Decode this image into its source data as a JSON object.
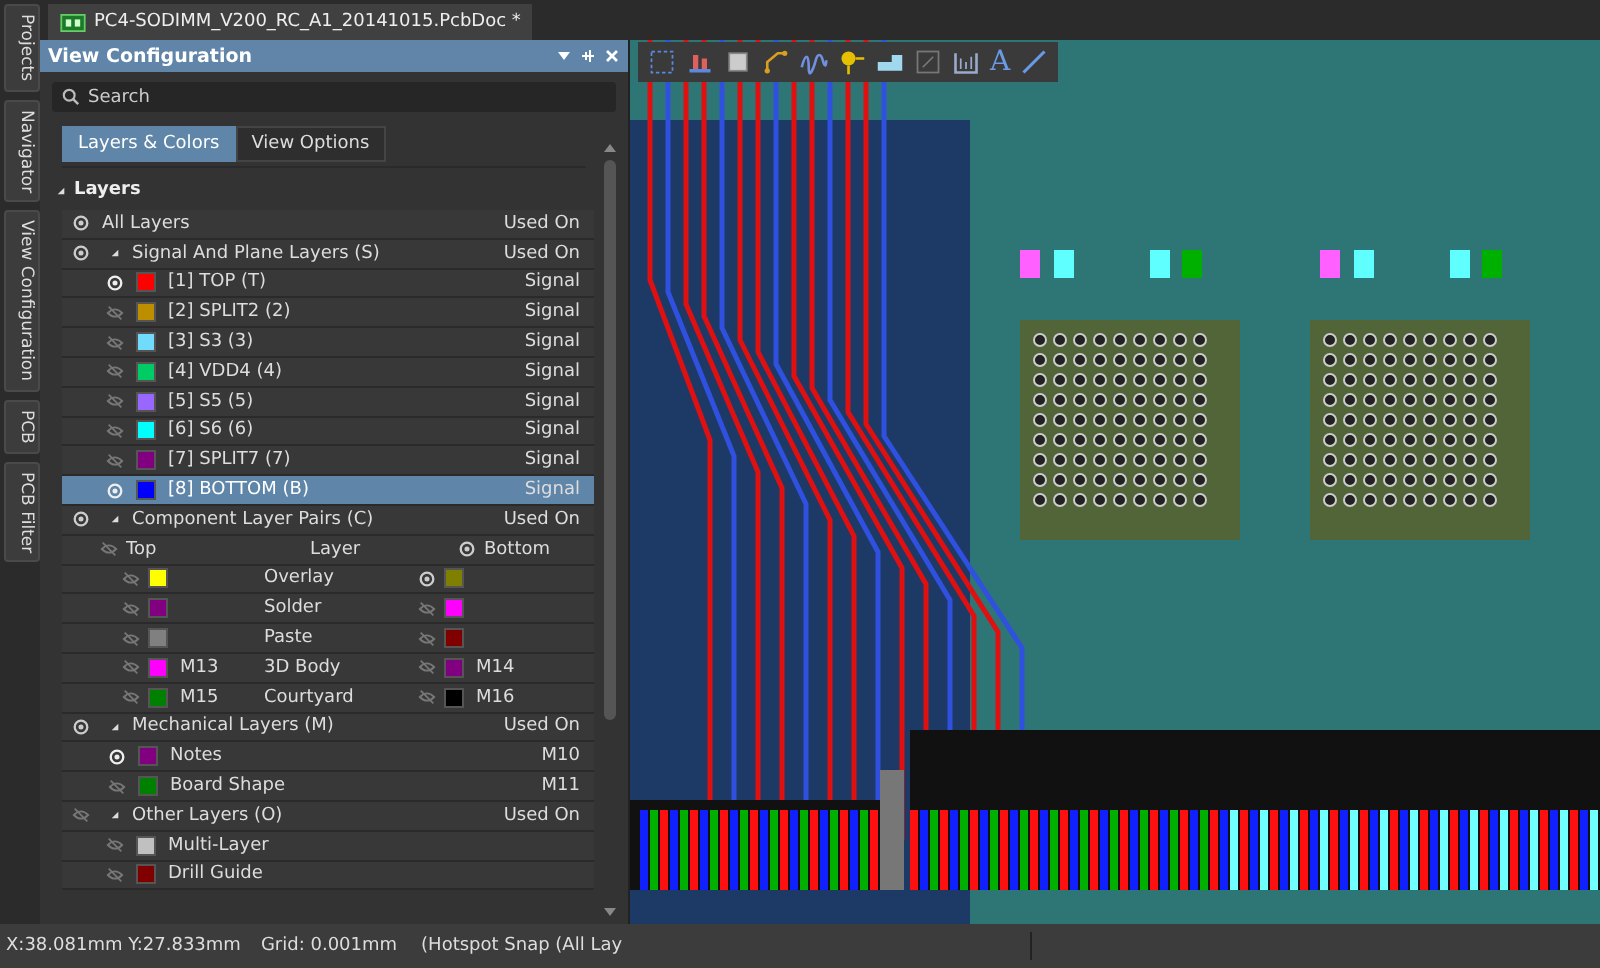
{
  "document_tab": {
    "title": "PC4-SODIMM_V200_RC_A1_20141015.PcbDoc *"
  },
  "side_tabs": [
    {
      "label": "Projects"
    },
    {
      "label": "Navigator"
    },
    {
      "label": "View Configuration"
    },
    {
      "label": "PCB"
    },
    {
      "label": "PCB Filter"
    }
  ],
  "panel": {
    "title": "View Configuration",
    "search": {
      "placeholder": "Search"
    },
    "tabs": [
      {
        "label": "Layers & Colors",
        "selected": true
      },
      {
        "label": "View Options",
        "selected": false
      }
    ],
    "section": {
      "label": "Layers",
      "expanded": true
    },
    "all_layers": {
      "label": "All Layers",
      "used_on": "Used On",
      "visible": true
    },
    "signal_layers": {
      "label": "Signal And Plane Layers (S)",
      "used_on": "Used On",
      "visible": true,
      "expanded": true,
      "rows": [
        {
          "name": "[1] TOP (T)",
          "color": "#ff0000",
          "visible": true,
          "used_on": "Signal",
          "selected": false
        },
        {
          "name": "[2] SPLIT2 (2)",
          "color": "#bc8e00",
          "visible": false,
          "used_on": "Signal",
          "selected": false
        },
        {
          "name": "[3] S3 (3)",
          "color": "#70dbfa",
          "visible": false,
          "used_on": "Signal",
          "selected": false
        },
        {
          "name": "[4] VDD4 (4)",
          "color": "#00cc66",
          "visible": false,
          "used_on": "Signal",
          "selected": false
        },
        {
          "name": "[5] S5 (5)",
          "color": "#9966ff",
          "visible": false,
          "used_on": "Signal",
          "selected": false
        },
        {
          "name": "[6] S6 (6)",
          "color": "#00ffff",
          "visible": false,
          "used_on": "Signal",
          "selected": false
        },
        {
          "name": "[7] SPLIT7 (7)",
          "color": "#800080",
          "visible": false,
          "used_on": "Signal",
          "selected": false
        },
        {
          "name": "[8] BOTTOM (B)",
          "color": "#0000ff",
          "visible": true,
          "used_on": "Signal",
          "selected": true
        }
      ]
    },
    "component_pairs": {
      "label": "Component Layer Pairs (C)",
      "used_on": "Used On",
      "visible": true,
      "expanded": true,
      "columns": {
        "top": "Top",
        "top_visible": false,
        "layer": "Layer",
        "bottom": "Bottom",
        "bottom_visible": true
      },
      "rows": [
        {
          "layer": "Overlay",
          "top": {
            "color": "#ffff00",
            "visible": false
          },
          "bottom": {
            "color": "#808000",
            "visible": true
          }
        },
        {
          "layer": "Solder",
          "top": {
            "color": "#800080",
            "visible": false
          },
          "bottom": {
            "color": "#ff00ff",
            "visible": false
          }
        },
        {
          "layer": "Paste",
          "top": {
            "color": "#808080",
            "visible": false
          },
          "bottom": {
            "color": "#800000",
            "visible": false
          }
        },
        {
          "layer": "3D Body",
          "top": {
            "color": "#ff00ff",
            "label": "M13",
            "visible": false
          },
          "bottom": {
            "color": "#800080",
            "label": "M14",
            "visible": false
          }
        },
        {
          "layer": "Courtyard",
          "top": {
            "color": "#008000",
            "label": "M15",
            "visible": false
          },
          "bottom": {
            "color": "#000000",
            "label": "M16",
            "visible": false
          }
        }
      ]
    },
    "mechanical_layers": {
      "label": "Mechanical Layers (M)",
      "used_on": "Used On",
      "visible": true,
      "expanded": true,
      "rows": [
        {
          "name": "Notes",
          "color": "#800080",
          "visible": true,
          "used_on": "M10"
        },
        {
          "name": "Board Shape",
          "color": "#008000",
          "visible": false,
          "used_on": "M11"
        }
      ]
    },
    "other_layers": {
      "label": "Other Layers (O)",
      "used_on": "Used On",
      "visible": false,
      "expanded": true,
      "rows": [
        {
          "name": "Multi-Layer",
          "color": "#c0c0c0",
          "visible": false
        },
        {
          "name": "Drill Guide",
          "color": "#800000",
          "visible": false
        }
      ]
    }
  },
  "toolbar": {
    "text_glyph": "A"
  },
  "status_bar": {
    "coordinates": "X:38.081mm Y:27.833mm",
    "grid": "Grid: 0.001mm",
    "snap": "(Hotspot Snap (All Lay"
  }
}
